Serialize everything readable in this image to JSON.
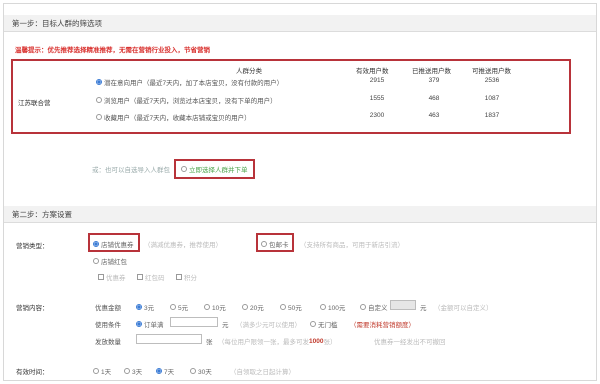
{
  "step1": {
    "header": "第一步：目标人群的筛选项",
    "hint": "温馨提示：优先推荐选择精准推荐，无需在营销行业投入，节省营销",
    "group_label": "江苏联合营",
    "columns": [
      "人群分类",
      "有效用户数",
      "已推送用户数",
      "可推送用户数"
    ],
    "rows": [
      {
        "label": "潜在意向用户（最近7天内，加了本店宝贝，没有付款的用户）",
        "total": "2915",
        "sent": "379",
        "available": "2536"
      },
      {
        "label": "浏览用户（最近7天内，浏览过本店宝贝，没有下单的用户）",
        "total": "1555",
        "sent": "468",
        "available": "1087"
      },
      {
        "label": "收藏用户（最近7天内，收藏本店铺或宝贝的用户）",
        "total": "2300",
        "sent": "463",
        "available": "1837"
      }
    ],
    "link_text": "或：也可以自选导入人群包",
    "submit_label": "立即选择人群并下单"
  },
  "step2": {
    "header": "第二步：方案设置",
    "type_label": "营销类型：",
    "type_opt1": "店铺优惠券",
    "type_opt2": "（满减优惠券，推荐使用）",
    "type_opt3": "包邮卡",
    "type_opt4": "（支持所有商品，可用于新店引流）",
    "type_opt5": "店铺红包",
    "sub_opts": [
      "优惠券",
      "红包码",
      "积分"
    ],
    "content_label": "营销内容：",
    "amount_label": "优惠金额",
    "amounts": [
      "3元",
      "5元",
      "10元",
      "20元",
      "50元",
      "100元",
      "自定义"
    ],
    "amount_unit": "元",
    "amount_note": "（金额可以自定义）",
    "threshold_label": "使用条件",
    "threshold_opt1": "订单满",
    "threshold_unit": "元",
    "threshold_note": "（满多少元可以使用）",
    "threshold_opt2": "无门槛",
    "threshold_hint": "（需要消耗营销额度）",
    "qty_label": "发放数量",
    "qty_unit": "张",
    "qty_note": "（每位用户限领一张，最多可发",
    "qty_max": "1000",
    "qty_note2": "张）",
    "qty_tail": "优惠券一经发出不可撤回",
    "time_label": "有效时间：",
    "times": [
      "1天",
      "3天",
      "7天",
      "30天"
    ],
    "time_note": "（自领取之日起计算）"
  }
}
